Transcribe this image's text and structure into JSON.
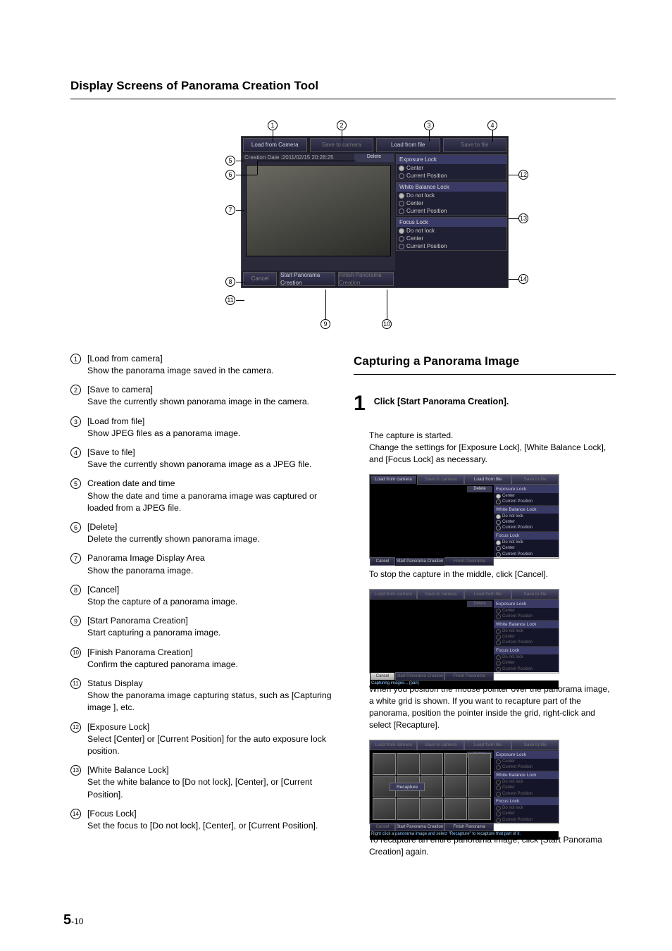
{
  "heading": "Display Screens of Panorama Creation Tool",
  "figure": {
    "buttons": {
      "load_camera": "Load from Camera",
      "save_camera": "Save to camera",
      "load_file": "Load from file",
      "save_file": "Save to file",
      "delete": "Delete",
      "cancel": "Cancel",
      "start": "Start Panorama Creation",
      "finish": "Finish Panorama Creation"
    },
    "creation_date": "Creation Date :2011/02/15 20:28:25",
    "panels": {
      "exposure": {
        "title": "Exposure Lock",
        "opts": [
          "Center",
          "Current Position"
        ]
      },
      "white": {
        "title": "White Balance Lock",
        "opts": [
          "Do not lock",
          "Center",
          "Current Position"
        ]
      },
      "focus": {
        "title": "Focus Lock",
        "opts": [
          "Do not lock",
          "Center",
          "Current Position"
        ]
      }
    }
  },
  "items": [
    {
      "n": "1",
      "label": "[Load from camera]",
      "desc": "Show the panorama image saved in the camera."
    },
    {
      "n": "2",
      "label": "[Save to camera]",
      "desc": "Save the currently shown panorama image in the camera."
    },
    {
      "n": "3",
      "label": "[Load from file]",
      "desc": "Show JPEG files as a panorama image."
    },
    {
      "n": "4",
      "label": "[Save to file]",
      "desc": "Save the currently shown panorama image as a JPEG file."
    },
    {
      "n": "5",
      "label": "Creation date and time",
      "desc": "Show the date and time a panorama image was captured or loaded from a JPEG file."
    },
    {
      "n": "6",
      "label": "[Delete]",
      "desc": "Delete the currently shown panorama image."
    },
    {
      "n": "7",
      "label": "Panorama Image Display Area",
      "desc": "Show the panorama image."
    },
    {
      "n": "8",
      "label": "[Cancel]",
      "desc": "Stop the capture of a panorama image."
    },
    {
      "n": "9",
      "label": "[Start Panorama Creation]",
      "desc": "Start capturing a panorama image."
    },
    {
      "n": "10",
      "label": "[Finish Panorama Creation]",
      "desc": "Confirm the captured panorama image."
    },
    {
      "n": "11",
      "label": "Status Display",
      "desc": "Show the panorama image capturing status, such as [Capturing image ], etc."
    },
    {
      "n": "12",
      "label": "[Exposure Lock]",
      "desc": "Select [Center] or [Current Position] for the auto exposure lock position."
    },
    {
      "n": "13",
      "label": "[White Balance Lock]",
      "desc": "Set the white balance to [Do not lock], [Center], or [Current Position]."
    },
    {
      "n": "14",
      "label": "[Focus Lock]",
      "desc": "Set the focus to [Do not lock], [Center], or [Current Position]."
    }
  ],
  "sub_heading": "Capturing a Panorama Image",
  "step1": {
    "num": "1",
    "text": "Click [Start Panorama Creation]."
  },
  "body": {
    "p1a": "The capture is started.",
    "p1b": "Change the settings for [Exposure Lock], [White Balance Lock], and [Focus Lock] as necessary.",
    "p2": "To stop the capture in the middle, click [Cancel].",
    "p3": "When you position the mouse pointer over the panorama image, a white grid is shown. If you want to recapture part of the panorama, position the pointer inside the grid, right-click and select [Recapture].",
    "p4": "To recapture an entire panorama image, click [Start Panorama Creation] again."
  },
  "mini_labels": {
    "load_camera": "Load from camera",
    "save_camera": "Save to camera",
    "load_file": "Load from file",
    "save_file": "Save to file",
    "delete": "Delete",
    "cancel": "Cancel",
    "start": "Start Panorama Creation",
    "finish": "Finish Panorama Creation",
    "exposure": "Exposure Lock",
    "white": "White Balance Lock",
    "focus": "Focus Lock",
    "opt_dnl": "Do not lock",
    "opt_center": "Center",
    "opt_cur": "Current Position",
    "status": "Capturing images... (pan)",
    "recapture": "Recapture",
    "recapture_hint": "Right click a panorama image and select \"Recapture\" to recapture that part of it."
  },
  "page_number": {
    "chapter": "5",
    "sub": "-10"
  }
}
